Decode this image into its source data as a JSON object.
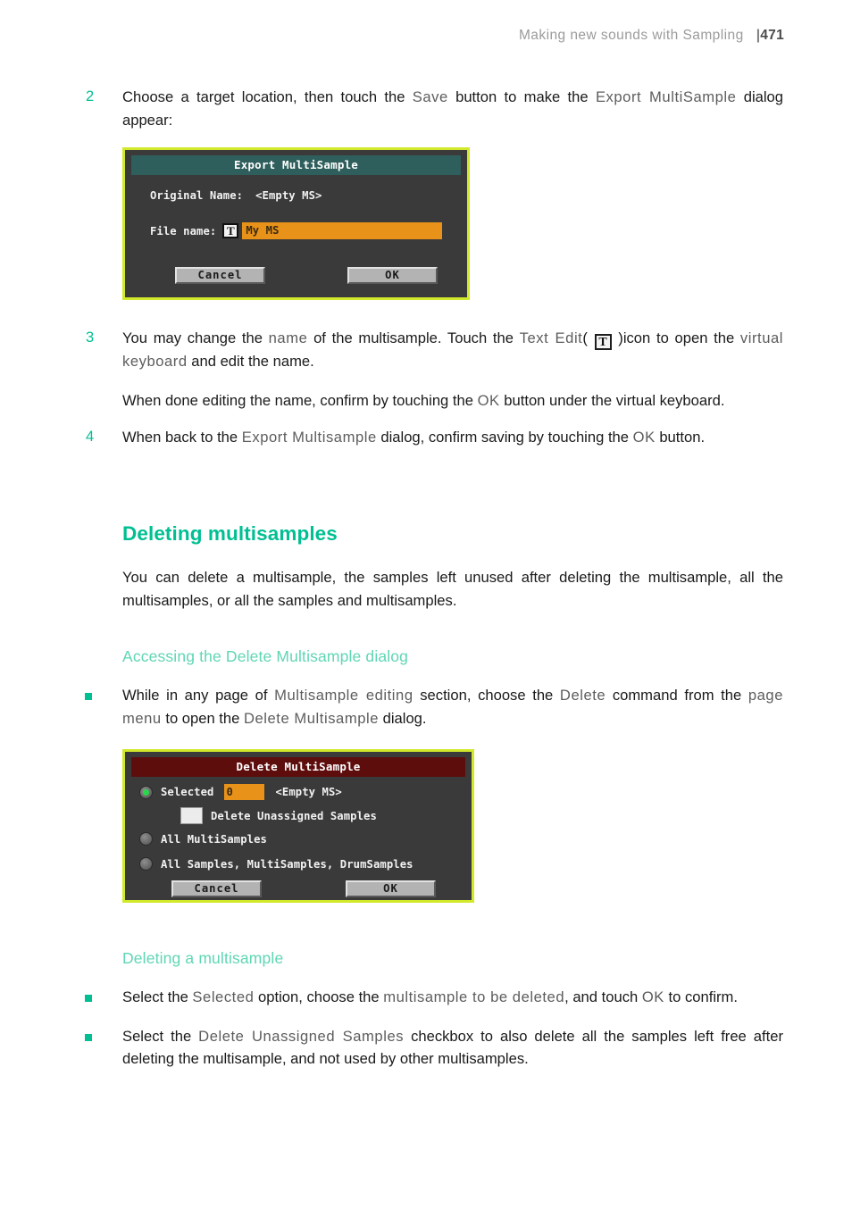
{
  "header": {
    "title": "Making new sounds with Sampling",
    "separator": "|",
    "page_number": "471"
  },
  "steps": {
    "step2": {
      "number": "2",
      "line1_a": "Choose a target location, then touch the ",
      "line1_ui1": "Save",
      "line1_b": " button to make the ",
      "line1_ui2": "Export MultiSample",
      "line1_c": " dialog appear:"
    },
    "step3": {
      "number": "3",
      "line1_a": "You may change the ",
      "line1_ui1": "name",
      "line1_b": " of the multisample. Touch the ",
      "line1_ui2": "Text Edit",
      "line1_paren_open": "( ",
      "line1_icon": "T",
      "line1_paren_close": " )",
      "line2_a": "icon to open the ",
      "line2_ui1": "virtual keyboard",
      "line2_b": " and edit the name.",
      "para_a": "When done editing the name, confirm by touching the ",
      "para_ui": "OK",
      "para_b": " button under the virtual keyboard."
    },
    "step4": {
      "number": "4",
      "line_a": "When back to the ",
      "line_ui1": "Export Multisample",
      "line_b": " dialog, confirm saving by touching the ",
      "line_ui2": "OK",
      "line_c": " button."
    }
  },
  "export_dialog": {
    "title": "Export MultiSample",
    "original_name_label": "Original Name:",
    "original_name_value": "<Empty MS>",
    "file_name_label": "File name:",
    "text_edit_icon": "T",
    "file_name_value": "My MS",
    "cancel_label": "Cancel",
    "ok_label": "OK",
    "border_color": "#d2e82a",
    "titlebar_color": "#2f5f5c",
    "field_color": "#e8921a"
  },
  "section": {
    "heading": "Deleting multisamples",
    "intro": "You can delete a multisample, the samples left unused after deleting the multisample, all the multisamples, or all the samples and multisamples.",
    "subheading_access": "Accessing the Delete Multisample dialog",
    "subheading_deleting": "Deleting a multisample",
    "heading_color": "#00bf92",
    "subheading_color": "#5fd6b4"
  },
  "bullets": {
    "access": {
      "a": "While in any page of ",
      "ui1": "Multisample editing",
      "b": " section, choose the ",
      "ui2": "Delete",
      "c": " command from the ",
      "ui3": "page menu",
      "d": " to open the ",
      "ui4": "Delete Multisample",
      "e": " dialog."
    },
    "deleting1": {
      "a": "Select the ",
      "ui1": "Selected",
      "b": " option, choose the ",
      "ui2": "multisample to be deleted",
      "c": ", and touch ",
      "ui3": "OK",
      "d": " to confirm."
    },
    "deleting2": {
      "a": "Select the ",
      "ui1": "Delete Unassigned Samples",
      "b": " checkbox to also delete all the samples left free after deleting the multisample, and not used by other multisamples."
    }
  },
  "delete_dialog": {
    "title": "Delete MultiSample",
    "option_selected_label": "Selected",
    "option_selected_value": "0",
    "option_selected_name": "<Empty MS>",
    "checkbox_label": "Delete Unassigned Samples",
    "option_all_multisamples": "All MultiSamples",
    "option_all_samples": "All Samples, MultiSamples, DrumSamples",
    "cancel_label": "Cancel",
    "ok_label": "OK",
    "border_color": "#d2e82a",
    "titlebar_color": "#5e0d0d",
    "radio_on_color": "#2bd64a",
    "field_color": "#e8921a"
  }
}
